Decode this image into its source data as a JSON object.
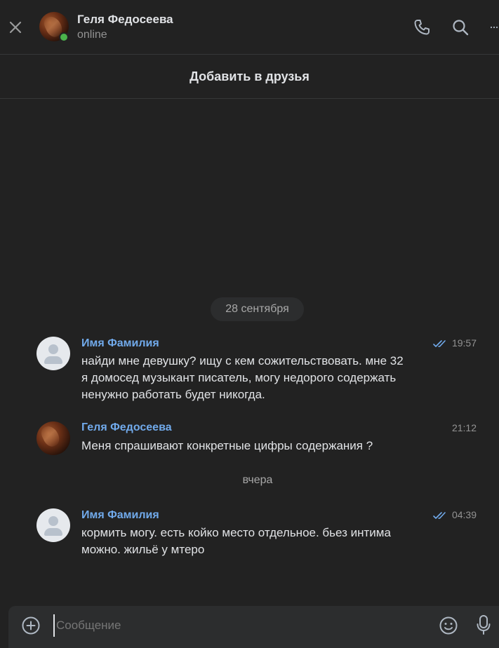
{
  "header": {
    "peer_name": "Геля Федосеева",
    "status": "online",
    "icons": {
      "close": "close-icon",
      "call": "phone-icon",
      "search": "search-icon",
      "more": "more-icon"
    }
  },
  "add_friend": {
    "label": "Добавить в друзья"
  },
  "dates": {
    "first": "28 сентября",
    "second": "вчера"
  },
  "messages": [
    {
      "author": "Имя Фамилия",
      "time": "19:57",
      "lines": [
        "найди мне девушку? ищу с кем сожительствовать. мне 32",
        "я домосед музыкант писатель, могу недорого содержать",
        "ненужно работать будет никогда."
      ],
      "read": true
    },
    {
      "author": "Геля Федосеева",
      "time": "21:12",
      "lines": [
        "Меня спрашивают конкретные цифры содержания ?"
      ],
      "read": false
    },
    {
      "author": "Имя Фамилия",
      "time": "04:39",
      "lines": [
        "кормить могу. есть койко место отдельное. бьез интима",
        "можно. жильё у мтеро"
      ],
      "read": true
    }
  ],
  "composer": {
    "placeholder": "Сообщение"
  },
  "colors": {
    "background": "#222222",
    "accent": "#71aaeb",
    "online": "#4bb34b"
  }
}
